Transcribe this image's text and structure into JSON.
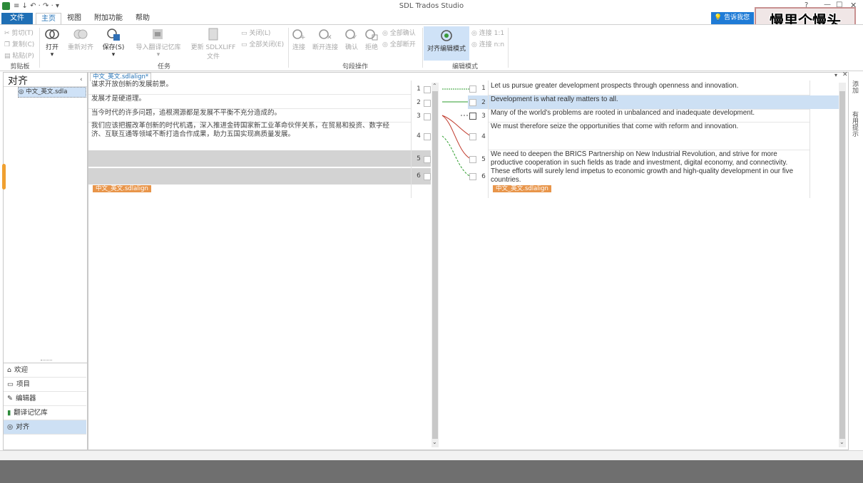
{
  "app": {
    "title": "SDL Trados Studio",
    "quick_access": "≡ ↓ ↶ · ↷ · ▾"
  },
  "tabs": [
    "文件",
    "主页",
    "视图",
    "附加功能",
    "帮助"
  ],
  "notify": {
    "text": "告诉我您想"
  },
  "watermark": {
    "text": "慢里个慢头"
  },
  "ribbon": {
    "clipboard": {
      "cut": "剪切(T)",
      "copy": "复制(C)",
      "paste": "粘贴(P)",
      "group": "剪贴板"
    },
    "tasks": {
      "open": "打开",
      "realign": "重新对齐",
      "save": "保存(S)",
      "import_tm": "导入翻译记忆库",
      "update": "更新 SDLXLIFF",
      "update2": "文件",
      "close": "关闭(L)",
      "close_all": "全部关闭(E)",
      "group": "任务"
    },
    "segment_ops": {
      "connect": "连接",
      "disconnect": "断开连接",
      "confirm": "确认",
      "reject": "拒绝",
      "confirm_all": "全部确认",
      "disconnect_all": "全部断开",
      "group": "句段操作"
    },
    "edit_mode": {
      "align_edit": "对齐编辑模式",
      "connect_11": "连接 1:1",
      "connect_nn": "连接 n:n",
      "group": "编辑模式"
    }
  },
  "left_panel": {
    "title": "对齐",
    "tree_item": "中文_英文.sdla",
    "nav": [
      "欢迎",
      "项目",
      "编辑器",
      "翻译记忆库",
      "对齐"
    ]
  },
  "doc_tab": "中文_英文.sdlalign*",
  "file_tag": "中文_英文.sdlalign",
  "right_tabs": [
    "添加",
    "有用提示"
  ],
  "source_segments": [
    {
      "num": "1",
      "text": "谋求开放创新的发展前景。"
    },
    {
      "num": "2",
      "text": "发展才是硬道理。"
    },
    {
      "num": "3",
      "text": "当今时代的许多问题，追根溯源都是发展不平衡不充分造成的。"
    },
    {
      "num": "4",
      "text": "我们应该把握改革创新的时代机遇，深入推进金砖国家新工业革命伙伴关系，在贸易和投资、数字经济、互联互通等领域不断打造合作成果，助力五国实现高质量发展。"
    },
    {
      "num": "5",
      "text": ""
    },
    {
      "num": "6",
      "text": ""
    }
  ],
  "target_segments": [
    {
      "num": "1",
      "text": "Let us pursue greater development prospects through openness and innovation."
    },
    {
      "num": "2",
      "text": "Development is what really matters to all."
    },
    {
      "num": "3",
      "text": "Many of the world's problems are rooted in unbalanced and inadequate development."
    },
    {
      "num": "4",
      "text": "We must therefore seize the opportunities that come with reform and innovation."
    },
    {
      "num": "5",
      "text": "We need to deepen the BRICS Partnership on New Industrial Revolution, and strive for more productive cooperation in such fields as trade and investment, digital economy, and connectivity. These efforts will surely lend impetus to economic growth and high-quality development in our five countries."
    },
    {
      "num": "6",
      "text": ""
    }
  ],
  "colors": {
    "accent": "#1f6fb5",
    "tag": "#e8954a",
    "selection": "#cde0f4",
    "link_solid": "#2e9e2e",
    "link_red": "#c0392b"
  },
  "icons": [
    "cut-icon",
    "copy-icon",
    "paste-icon",
    "open-icon",
    "realign-icon",
    "save-icon",
    "import-tm-icon",
    "update-icon",
    "close-icon",
    "close-all-icon",
    "connect-icon",
    "disconnect-icon",
    "confirm-icon",
    "reject-icon",
    "align-edit-icon",
    "lightbulb-icon",
    "home-icon",
    "folder-icon",
    "pencil-icon",
    "book-icon",
    "align-icon"
  ]
}
